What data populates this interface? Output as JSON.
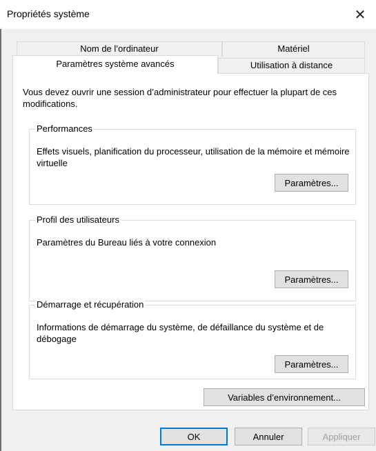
{
  "window": {
    "title": "Propriétés système",
    "close_icon": "close-icon",
    "close_glyph": "✕"
  },
  "tabs": {
    "back_row": [
      {
        "label": "Nom de l’ordinateur"
      },
      {
        "label": "Matériel"
      }
    ],
    "front_row": [
      {
        "label": "Paramètres système avancés",
        "active": true
      },
      {
        "label": "Utilisation à distance",
        "active": false
      }
    ]
  },
  "panel": {
    "intro": "Vous devez ouvrir une session d’administrateur pour effectuer la plupart de ces modifications.",
    "groups": [
      {
        "title": "Performances",
        "description": "Effets visuels, planification du processeur, utilisation de la mémoire et mémoire virtuelle",
        "button": "Paramètres..."
      },
      {
        "title": "Profil des utilisateurs",
        "description": "Paramètres du Bureau liés à votre connexion",
        "button": "Paramètres..."
      },
      {
        "title": "Démarrage et récupération",
        "description": "Informations de démarrage du système, de défaillance du système et de débogage",
        "button": "Paramètres..."
      }
    ],
    "env_button": "Variables d’environnement..."
  },
  "footer": {
    "ok": "OK",
    "cancel": "Annuler",
    "apply": "Appliquer"
  }
}
